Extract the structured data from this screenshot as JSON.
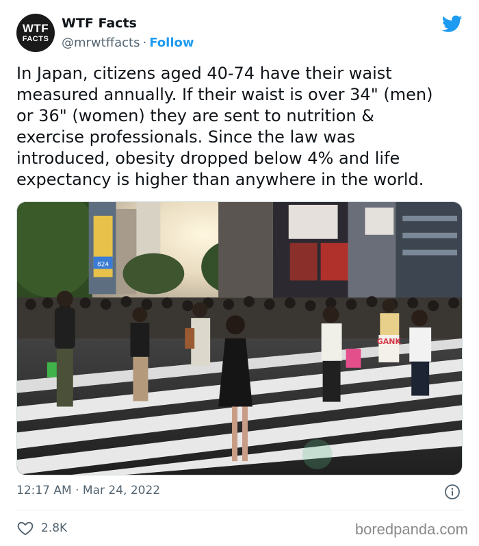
{
  "account": {
    "avatar_line1": "WTF",
    "avatar_line2": "FACTS",
    "name": "WTF Facts",
    "handle": "@mrwtffacts",
    "separator": "·",
    "follow_label": "Follow"
  },
  "tweet": {
    "text": "In Japan, citizens aged 40-74 have their waist\nmeasured annually. If their waist is over 34\" (men)\nor 36\" (women) they are sent to nutrition &\nexercise professionals. Since the law was\nintroduced, obesity dropped below 4% and life\nexpectancy is higher than anywhere in the world.",
    "time": "12:17 AM",
    "date_separator": "·",
    "date": "Mar 24, 2022",
    "like_count": "2.8K"
  },
  "photo": {
    "sign_number": "824",
    "sign_text": "GANK"
  },
  "icons": {
    "platform": "twitter-bird-icon",
    "info": "info-icon",
    "like": "heart-icon"
  },
  "colors": {
    "accent": "#1d9bf0",
    "secondary_text": "#536471",
    "primary_text": "#0f1419"
  },
  "watermark": "boredpanda.com"
}
